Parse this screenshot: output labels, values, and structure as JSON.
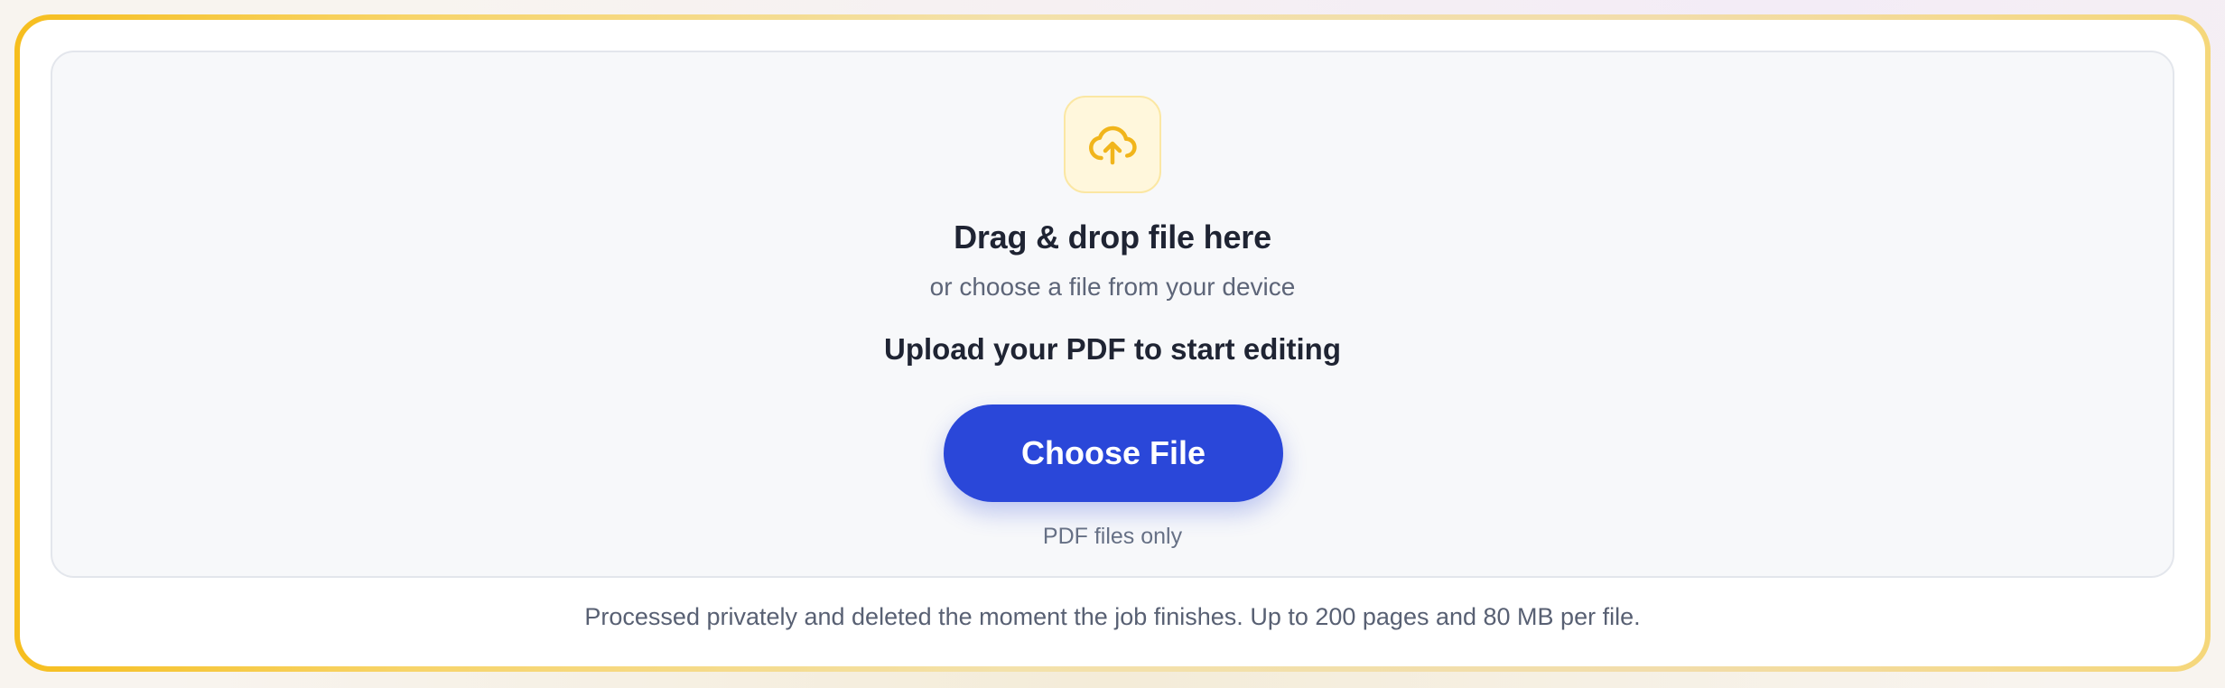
{
  "upload": {
    "icon": "cloud-upload-icon",
    "title": "Drag & drop file here",
    "subtitle": "or choose a file from your device",
    "cta_text": "Upload your PDF to start editing",
    "button_label": "Choose File",
    "hint": "PDF files only"
  },
  "footer": {
    "note": "Processed privately and deleted the moment the job finishes. Up to 200 pages and 80 MB per file."
  },
  "colors": {
    "accent": "#2a47d9",
    "frame": "#f6be1e",
    "icon": "#f1b51b"
  }
}
